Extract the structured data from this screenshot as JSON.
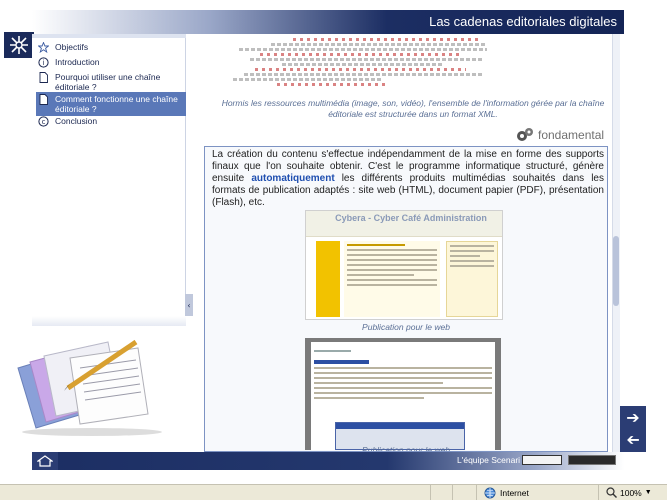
{
  "header": {
    "title": "Las cadenas editoriales digitales"
  },
  "sidebar": {
    "items": [
      {
        "label": "Objectifs",
        "icon": "star-icon",
        "active": false
      },
      {
        "label": "Introduction",
        "icon": "circle-info-icon",
        "active": false
      },
      {
        "label": "Pourquoi utiliser une chaîne éditoriale ?",
        "icon": "document-icon",
        "active": false
      },
      {
        "label": "Comment fonctionne une chaîne éditoriale ?",
        "icon": "document-icon",
        "active": true
      },
      {
        "label": "Conclusion",
        "icon": "c-circle-icon",
        "active": false
      }
    ],
    "collapse_glyph": "‹"
  },
  "content": {
    "figure_caption": "Hormis les ressources multimédia (image, son, vidéo), l'ensemble de l'information gérée par la chaîne éditoriale est structurée dans un format XML.",
    "fondamental_label": "fondamental",
    "paragraph_before": "La création du contenu s'effectue indépendamment de la mise en forme des supports finaux que l'on souhaite obtenir. C'est le programme informatique structuré, génère ensuite ",
    "paragraph_emphasis": "automatiquement",
    "paragraph_after": " les différents produits multimédias souhaités dans les formats de publication adaptés : site web (HTML), document papier (PDF), présentation (Flash), etc.",
    "screenshot1_title": "Cybera - Cyber Café Administration",
    "screenshot1_caption": "Publication pour le web",
    "screenshot2_caption": "Publication pour le web"
  },
  "footer": {
    "credit": "L'équipe Scenari"
  },
  "statusbar": {
    "zone": "Internet",
    "zoom": "100%"
  },
  "colors": {
    "banner_dark": "#1c2e63",
    "nav_active": "#5a78b8",
    "emphasis": "#1e4eb0",
    "caption": "#5a6f95"
  }
}
